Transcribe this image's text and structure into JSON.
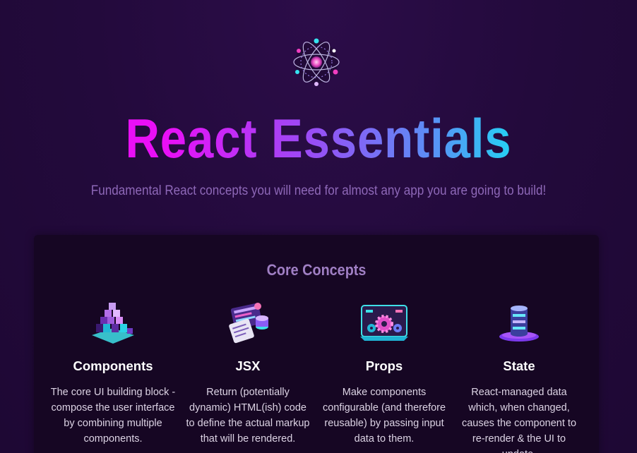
{
  "header": {
    "logo_icon": "atom-icon",
    "title": "React Essentials",
    "subtitle": "Fundamental React concepts you will need for almost any app you are going to build!"
  },
  "core_concepts": {
    "heading": "Core Concepts",
    "items": [
      {
        "icon": "components-cubes-icon",
        "title": "Components",
        "description": "The core UI building block - compose the user interface by combining multiple components."
      },
      {
        "icon": "jsx-code-icon",
        "title": "JSX",
        "description": "Return (potentially dynamic) HTML(ish) code to define the actual markup that will be rendered."
      },
      {
        "icon": "props-gears-icon",
        "title": "Props",
        "description": "Make components configurable (and therefore reusable) by passing input data to them."
      },
      {
        "icon": "state-database-icon",
        "title": "State",
        "description": "React-managed data which, when changed, causes the component to re-render & the UI to update."
      }
    ]
  },
  "colors": {
    "background": "#230a3c",
    "panel": "#160623",
    "title_gradient_start": "#e90ff6",
    "title_gradient_end": "#23d4f4",
    "subtitle": "#8e68b8",
    "heading": "#a07fc4"
  }
}
